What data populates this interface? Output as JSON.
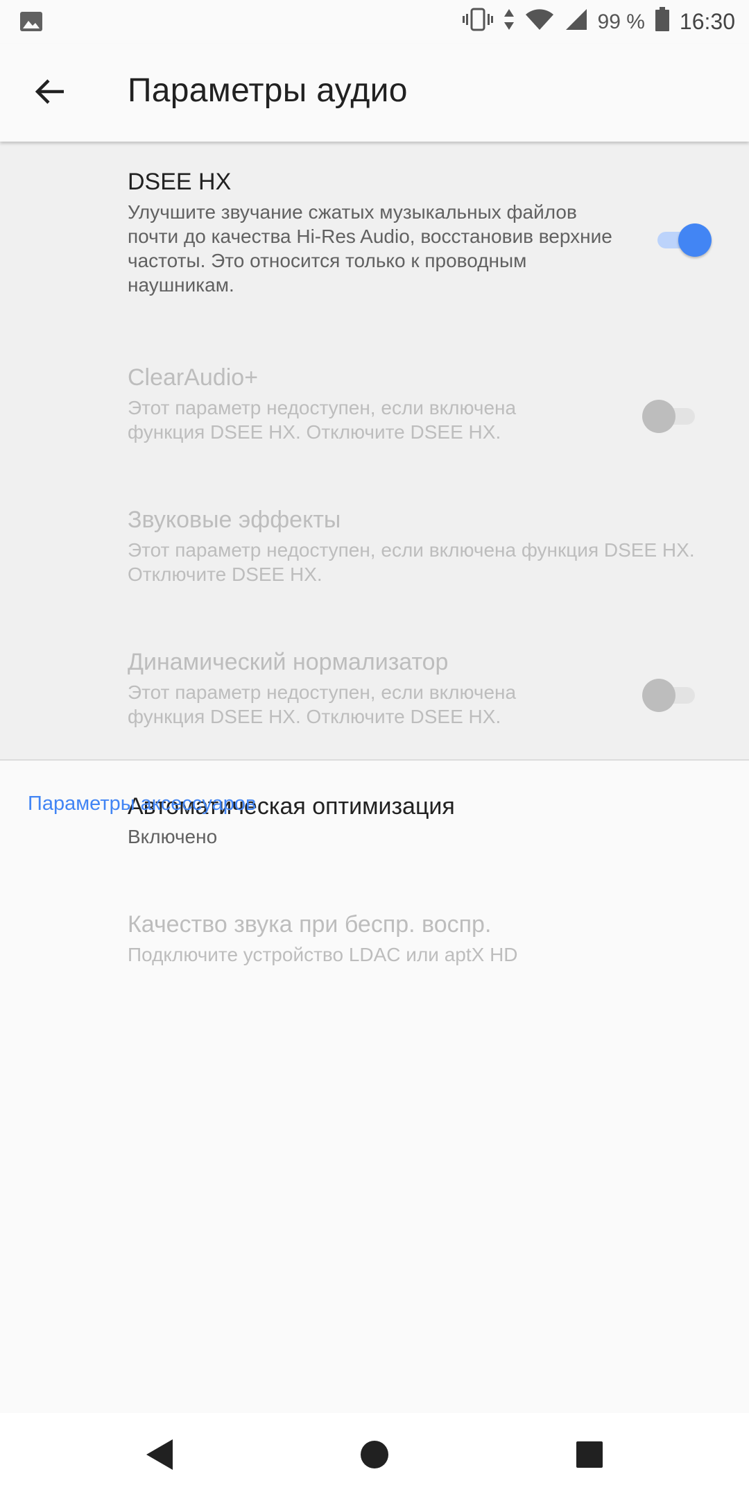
{
  "status_bar": {
    "battery_text": "99 %",
    "time": "16:30",
    "icons": [
      "image-icon",
      "vibrate-icon",
      "data-arrows-icon",
      "wifi-icon",
      "signal-icon",
      "battery-icon"
    ]
  },
  "app_bar": {
    "title": "Параметры аудио",
    "back_icon": "arrow-back-icon"
  },
  "preferences": [
    {
      "title": "DSEE HX",
      "summary": "Улучшите звучание сжатых музыкальных файлов почти до качества Hi-Res Audio, восстановив верхние частоты. Это относится только к проводным наушникам.",
      "enabled": true,
      "switch_on": true
    },
    {
      "title": "ClearAudio+",
      "summary": "Этот параметр недоступен, если включена функция DSEE HX. Отключите DSEE HX.",
      "enabled": false,
      "switch_on": false
    },
    {
      "title": "Звуковые эффекты",
      "summary": "Этот параметр недоступен, если включена функция DSEE HX. Отключите DSEE HX.",
      "enabled": false
    },
    {
      "title": "Динамический нормализатор",
      "summary": "Этот параметр недоступен, если включена функция DSEE HX. Отключите DSEE HX.",
      "enabled": false,
      "switch_on": false
    }
  ],
  "accessories": {
    "header": "Параметры аксессуаров",
    "items": [
      {
        "title": "Автоматическая оптимизация",
        "summary": "Включено",
        "enabled": true
      },
      {
        "title": "Качество звука при беспр. воспр.",
        "summary": "Подключите устройство LDAC или aptX HD",
        "enabled": false
      }
    ]
  },
  "colors": {
    "accent": "#4285f4",
    "disabled_text": "#bdbdbd",
    "background": "#fafafa"
  },
  "nav_bar": {
    "icons": [
      "back-triangle-icon",
      "home-circle-icon",
      "recents-square-icon"
    ]
  }
}
